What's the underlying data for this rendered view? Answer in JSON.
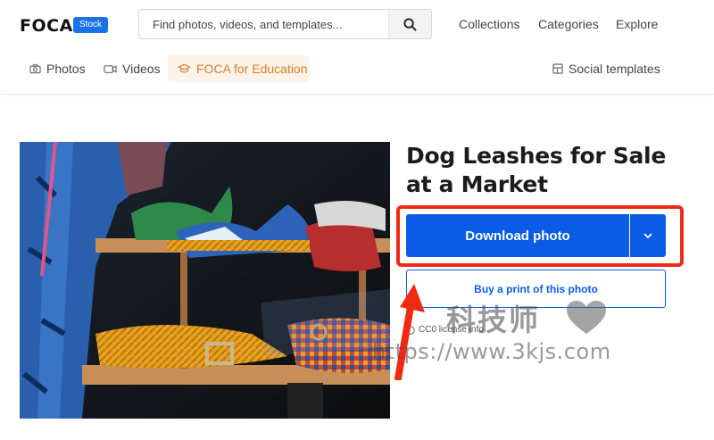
{
  "header": {
    "logo": "FOCA",
    "badge": "Stock",
    "search": {
      "placeholder": "Find photos, videos, and templates..."
    },
    "nav": [
      "Collections",
      "Categories",
      "Explore"
    ]
  },
  "subnav": {
    "photos": "Photos",
    "videos": "Videos",
    "education": "FOCA for Education",
    "social": "Social templates"
  },
  "main": {
    "title_line1": "Dog Leashes for Sale",
    "title_line2": "at a Market",
    "download_label": "Download photo",
    "print_label": "Buy a print of this photo",
    "license": "CC0 license info"
  },
  "watermark": {
    "chinese": "科技师",
    "url": "https://www.3kjs.com"
  },
  "colors": {
    "primary": "#0b5ce6",
    "badge": "#1a73e8",
    "highlight_frame": "#ee2a12",
    "education_text": "#d77d2c",
    "education_bg": "#fdf3e8"
  }
}
